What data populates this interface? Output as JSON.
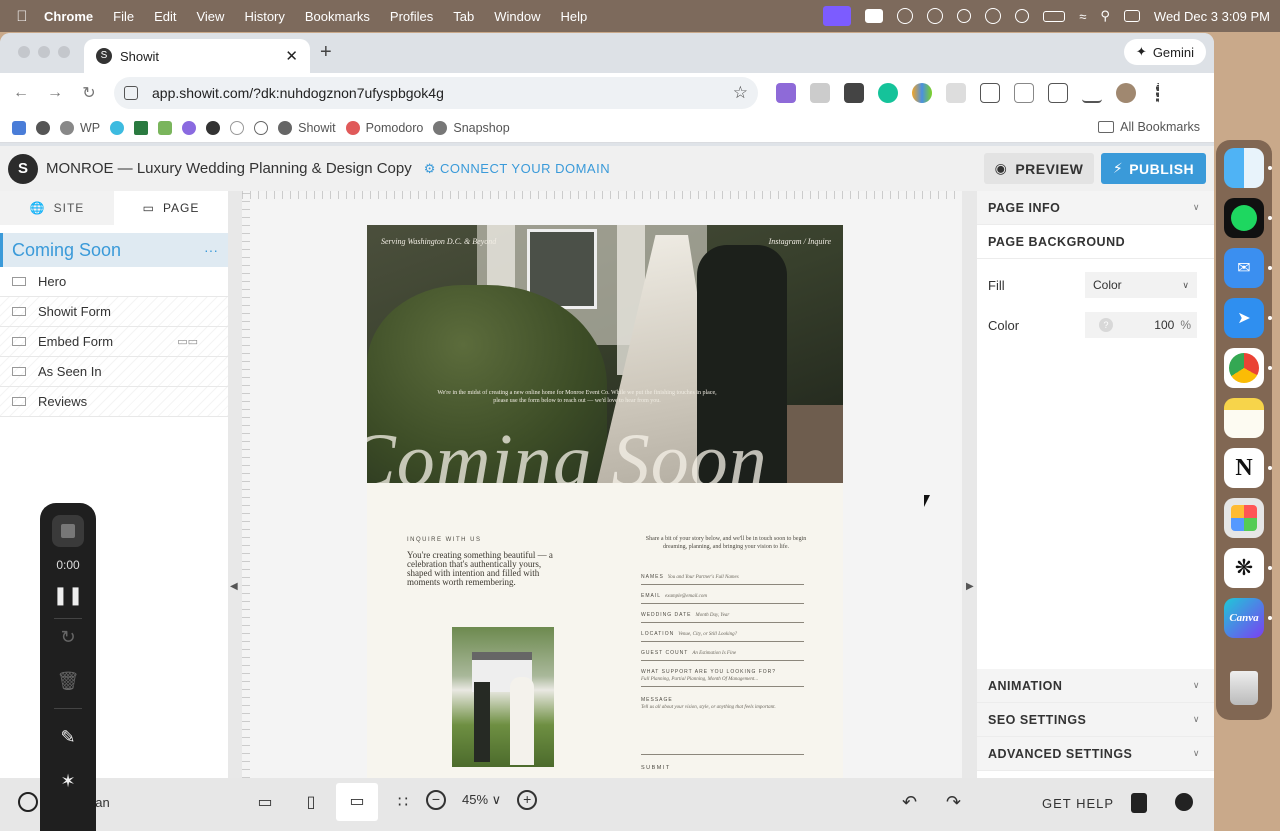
{
  "menubar": {
    "app": "Chrome",
    "items": [
      "File",
      "Edit",
      "View",
      "History",
      "Bookmarks",
      "Profiles",
      "Tab",
      "Window",
      "Help"
    ],
    "datetime": "Wed Dec 3  3:09 PM"
  },
  "browser": {
    "tab_title": "Showit",
    "new_tab": "+",
    "gemini": "Gemini",
    "url": "app.showit.com/?dk:nuhdogznon7ufyspbgok4g",
    "bookmarks": [
      "WP",
      "Showit",
      "Pomodoro",
      "Snapshop"
    ],
    "all_bookmarks": "All Bookmarks"
  },
  "app": {
    "site_title": "MONROE — Luxury Wedding Planning & Design Copy",
    "connect_domain": "CONNECT YOUR DOMAIN",
    "preview": "PREVIEW",
    "publish": "PUBLISH"
  },
  "left_panel": {
    "tabs": [
      "SITE",
      "PAGE"
    ],
    "page_name": "Coming Soon",
    "page_menu": "···",
    "sections": [
      "Hero",
      "Showit Form",
      "Embed Form",
      "As Seen In",
      "Reviews"
    ]
  },
  "canvas": {
    "hero": {
      "top_left": "Serving Washington D.C. & Beyond",
      "top_right": "Instagram / Inquire",
      "intro": "We're in the midst of creating a new online home for Monroe Event Co. While we put the finishing touches in place, please use the form below to reach out — we'd love to hear from you.",
      "headline": "Coming Soon"
    },
    "inquire_label": "INQUIRE WITH US",
    "inquire_title": "You're creating something beautiful — a celebration that's authentically yours, shaped with intention and filled with moments worth remembering.",
    "form_intro": "Share a bit of your story below, and we'll be in touch soon to begin dreaming, planning, and bringing your vision to life.",
    "fields": [
      {
        "label": "NAMES",
        "placeholder": "You and Your Partner's Full Names"
      },
      {
        "label": "EMAIL",
        "placeholder": "example@email.com"
      },
      {
        "label": "WEDDING DATE",
        "placeholder": "Month Day, Year"
      },
      {
        "label": "LOCATION",
        "placeholder": "Venue, City, or Still Looking?"
      },
      {
        "label": "GUEST COUNT",
        "placeholder": "An Estimation Is Fine"
      },
      {
        "label": "WHAT SUPPORT ARE YOU LOOKING FOR?",
        "placeholder": "Full Planning, Partial Planning, Month Of Management..."
      },
      {
        "label": "MESSAGE",
        "placeholder": "Tell us all about your vision, style, or anything that feels important."
      }
    ],
    "submit": "SUBMIT"
  },
  "right_panel": {
    "page_info": "PAGE INFO",
    "page_background": "PAGE BACKGROUND",
    "fill_label": "Fill",
    "fill_value": "Color",
    "color_label": "Color",
    "color_swatch": "?",
    "opacity": "100",
    "opacity_unit": "%",
    "animation": "ANIMATION",
    "seo": "SEO SETTINGS",
    "advanced": "ADVANCED SETTINGS"
  },
  "bottom_bar": {
    "user": "uan",
    "zoom": "45%",
    "get_help": "GET HELP"
  },
  "recorder": {
    "time": "0:00"
  },
  "dock": [
    "Finder",
    "Spotify",
    "Mail",
    "Safari",
    "Chrome",
    "Notes",
    "Notion",
    "Launchpad",
    "ChatGPT",
    "Canva",
    "Trash"
  ],
  "dock_icons": {
    "notion": "N",
    "canva": "Canva"
  }
}
